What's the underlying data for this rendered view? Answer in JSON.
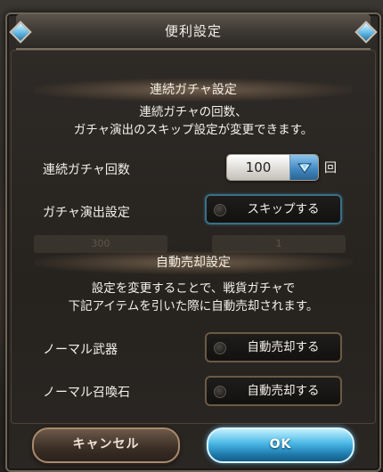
{
  "dialog": {
    "title": "便利設定"
  },
  "gacha_section": {
    "header": "連続ガチャ設定",
    "description_line1": "連続ガチャの回数、",
    "description_line2": "ガチャ演出のスキップ設定が変更できます。",
    "count_label": "連続ガチャ回数",
    "count_value": "100",
    "count_unit": "回",
    "effect_label": "ガチャ演出設定",
    "effect_toggle": "スキップする"
  },
  "auto_sell_section": {
    "header": "自動売却設定",
    "description_line1": "設定を変更することで、戦貨ガチャで",
    "description_line2": "下記アイテムを引いた際に自動売却されます。",
    "weapon_label": "ノーマル武器",
    "weapon_toggle": "自動売却する",
    "summon_label": "ノーマル召喚石",
    "summon_toggle": "自動売却する"
  },
  "buttons": {
    "cancel": "キャンセル",
    "ok": "OK"
  },
  "background": {
    "ghost_left": "300",
    "ghost_right": "1"
  },
  "icons": {
    "title_left": "blue-gem-icon",
    "title_right": "blue-gem-icon",
    "dropdown": "chevron-down-gem-icon",
    "toggle_indicator": "radio-dot-icon"
  },
  "colors": {
    "ok_button": "#48b7e6",
    "cancel_button": "#3a2e25",
    "panel_background": "#2a2623",
    "toggle_border": "#3a6f86"
  }
}
